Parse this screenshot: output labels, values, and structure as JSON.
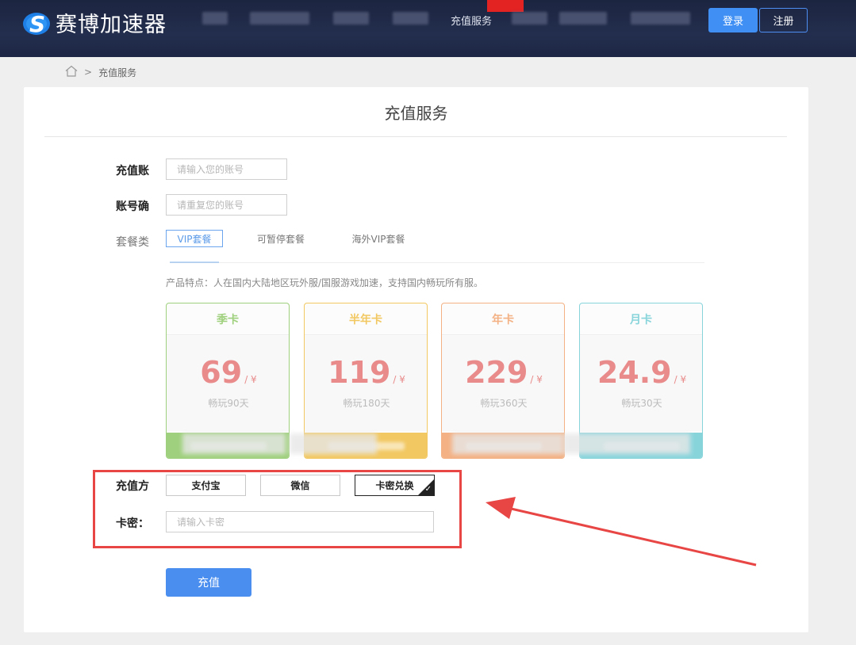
{
  "header": {
    "logo_text": "赛博加速器",
    "nav_active": "充值服务",
    "login_label": "登录",
    "register_label": "注册"
  },
  "breadcrumb": {
    "current": "充值服务"
  },
  "page": {
    "title": "充值服务"
  },
  "form": {
    "account_label": "充值账",
    "account_placeholder": "请输入您的账号",
    "confirm_label": "账号确",
    "confirm_placeholder": "请重复您的账号",
    "package_label": "套餐类",
    "tabs": [
      "VIP套餐",
      "可暂停套餐",
      "海外VIP套餐"
    ],
    "feature_text": "产品特点：人在国内大陆地区玩外服/国服游戏加速，支持国内畅玩所有服。",
    "plans": [
      {
        "name": "季卡",
        "price": "69",
        "unit": "/ ¥",
        "days": "畅玩90天",
        "color": "#9fd07d"
      },
      {
        "name": "半年卡",
        "price": "119",
        "unit": "/ ¥",
        "days": "畅玩180天",
        "color": "#f2c862"
      },
      {
        "name": "年卡",
        "price": "229",
        "unit": "/ ¥",
        "days": "畅玩360天",
        "color": "#f3b184"
      },
      {
        "name": "月卡",
        "price": "24.9",
        "unit": "/ ¥",
        "days": "畅玩30天",
        "color": "#88d4db"
      }
    ],
    "pay_label": "充值方",
    "pay_methods": [
      "支付宝",
      "微信",
      "卡密兑换"
    ],
    "card_label": "卡密：",
    "card_placeholder": "请输入卡密",
    "submit_label": "充值"
  },
  "colors": {
    "accent": "#4a8ff0",
    "annotation": "#e84545"
  }
}
